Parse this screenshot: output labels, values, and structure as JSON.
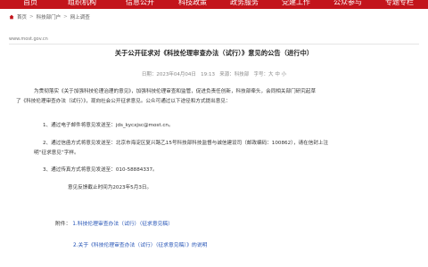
{
  "nav": {
    "items": [
      "首页",
      "组织机构",
      "信息公开",
      "科技政策",
      "政务服务",
      "党建工作",
      "公众参与",
      "专题专栏"
    ]
  },
  "breadcrumb": {
    "items": [
      "首页",
      "科技部门户",
      "网上调查"
    ],
    "separator": ">"
  },
  "site_url": "www.most.gov.cn",
  "article": {
    "title": "关于公开征求对《科技伦理审查办法（试行）》意见的公告（进行中）",
    "date_label": "日期：2023年04月04日",
    "time": "19:13",
    "source_label": "来源：科技部",
    "font_size_label": "字号：",
    "font_sizes": [
      "大",
      "中",
      "小"
    ],
    "intro_line1": "为贯彻落实《关于加强科技伦理治理的意见》，加强科技伦理审查和监管，促进负责任创新，科技部牵头，会同相关部门研究起草",
    "intro_line2": "了《科技伦理审查办法（试行）》，现向社会公开征求意见。公众可通过以下途径和方式提出意见：",
    "item1": "1、通过电子邮件将意见发送至：jds_kycxjsc@most.cn。",
    "item2_line1": "2、通过信函方式将意见发送至：北京市海淀区复兴路乙15号科技部科技监督与诚信建设司（邮政编码：100862），请在信封上注",
    "item2_line2": "明“征求意见”字样。",
    "item3": "3、通过传真方式将意见发送至：010-58884337。",
    "deadline": "意见反馈截止时间为2023年5月3日。",
    "attachments_label": "附件：",
    "attachment1": "1.科技伦理审查办法（试行）（征求意见稿）",
    "attachment2_link": "2.关于《科技伦理审查办法（试行）（征求意见稿）》的说明"
  },
  "colors": {
    "nav_bg": "#c3141b",
    "link": "#1f4fb4"
  }
}
